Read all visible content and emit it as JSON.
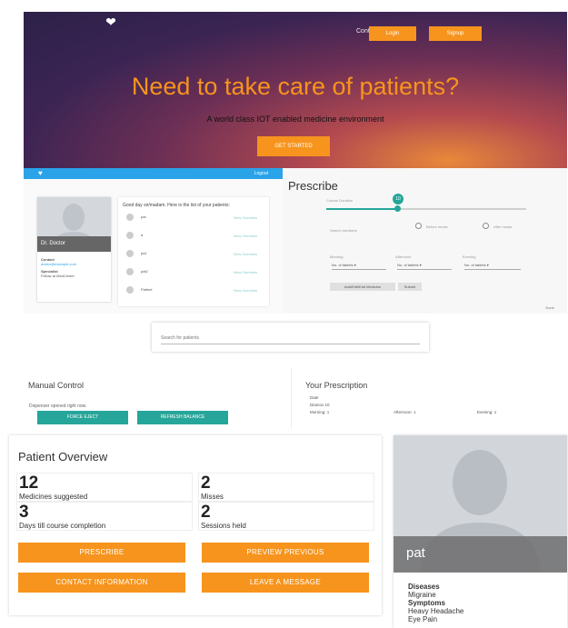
{
  "hero": {
    "nav_link": "Contact",
    "nav_buttons": [
      "Login",
      "Signup"
    ],
    "title": "Need to take care of patients?",
    "subtitle": "A world class IOT enabled medicine environment",
    "cta": "GET STARTED",
    "logo_icon": "heart-pulse-icon",
    "bg_colors": [
      "#2c2148",
      "#6d2f55",
      "#e8893a"
    ]
  },
  "dashboard": {
    "bar_link": "Logout",
    "card_name": "Dr. Doctor",
    "card_lines": [
      "Contact",
      "doctor@example.com",
      "Specialist",
      "Fellow at MedCenter"
    ],
    "greeting": "Good day sir/madam. Here is the list of your patients:",
    "patients": [
      {
        "name": "pat",
        "link": "View Overview"
      },
      {
        "name": "a",
        "link": "View Overview"
      },
      {
        "name": "pa1",
        "link": "View Overview"
      },
      {
        "name": "pat2",
        "link": "View Overview"
      },
      {
        "name": "Patient",
        "link": "View Overview"
      }
    ],
    "accent": "#2aa3e8"
  },
  "prescribe": {
    "title": "Prescribe",
    "slider_label": "Course Duration",
    "slider_value": "10",
    "slider_fraction": 0.35,
    "radio_options": [
      "Before meals",
      "After meals"
    ],
    "search_placeholder": "Search medicine",
    "selects": [
      {
        "label": "Morning",
        "value": "No. of tablets"
      },
      {
        "label": "Afternoon",
        "value": "No. of tablets"
      },
      {
        "label": "Evening",
        "value": "No. of tablets"
      }
    ],
    "buttons": [
      "Add/Edit/Edit Medicine",
      "Submit"
    ],
    "footer": "Done"
  },
  "search": {
    "placeholder": "Search for patients"
  },
  "manual_control": {
    "title": "Manual Control",
    "subtitle": "Dispenser opened right now.",
    "buttons": [
      "FORCE EJECT",
      "REFRESH BALANCE"
    ],
    "accent": "#26a69a"
  },
  "your_prescription": {
    "title": "Your Prescription",
    "lines": [
      "Date",
      "Diamox 10"
    ],
    "doses": [
      "Morning: 1",
      "Afternoon: 1",
      "Evening: 1"
    ]
  },
  "overview": {
    "title": "Patient Overview",
    "stats": [
      {
        "value": "12",
        "label": "Medicines suggested"
      },
      {
        "value": "2",
        "label": "Misses"
      },
      {
        "value": "3",
        "label": "Days till course completion"
      },
      {
        "value": "2",
        "label": "Sessions held"
      }
    ],
    "buttons": [
      "PRESCRIBE",
      "PREVIEW PREVIOUS",
      "CONTACT INFORMATION",
      "LEAVE A MESSAGE"
    ],
    "accent": "#f7941d"
  },
  "profile": {
    "name": "pat",
    "diseases_label": "Diseases",
    "diseases": "Migraine",
    "symptoms_label": "Symptoms",
    "symptoms": [
      "Heavy Headache",
      "Eye Pain"
    ],
    "avatar_icon": "person-silhouette-icon"
  }
}
